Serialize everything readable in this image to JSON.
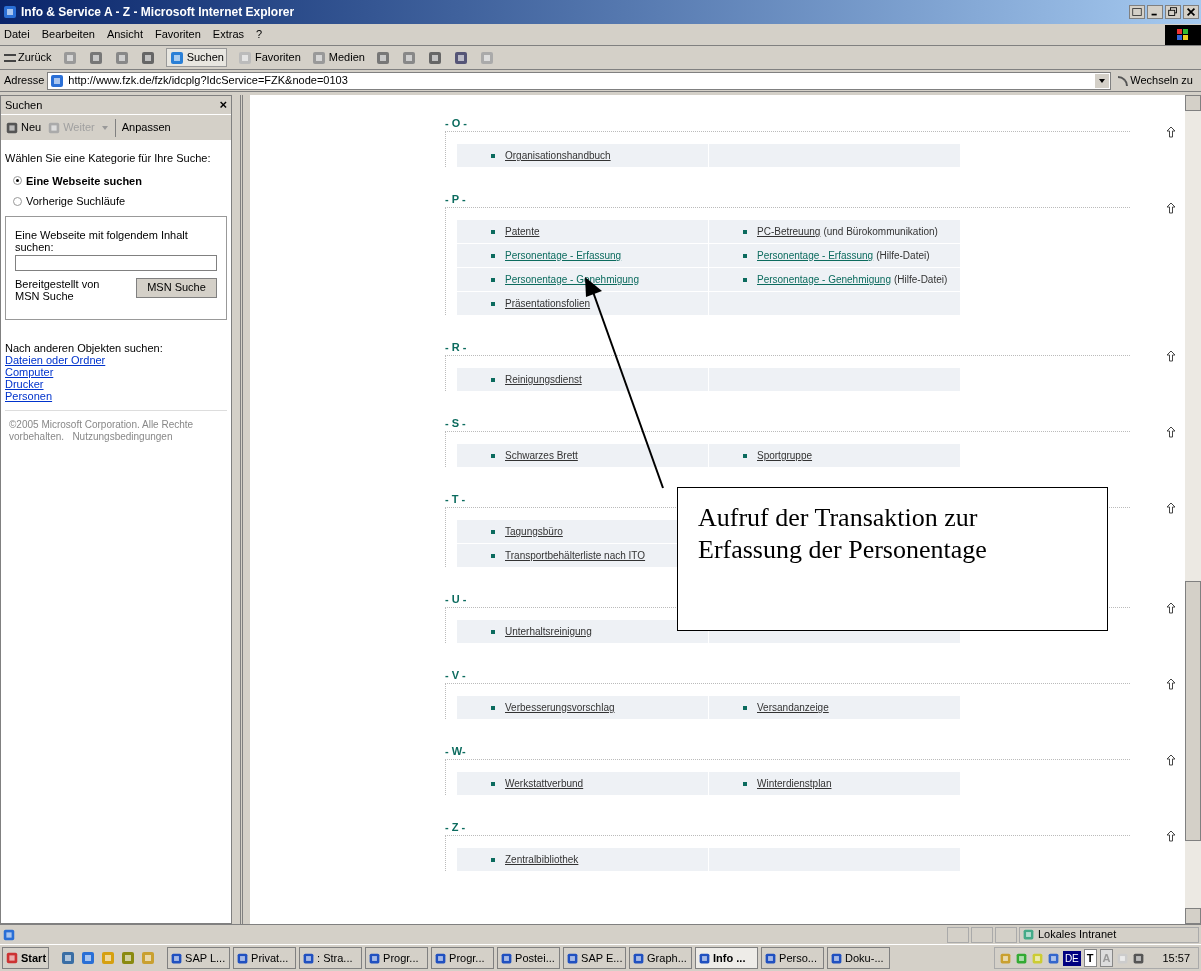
{
  "window": {
    "title": "Info & Service A - Z - Microsoft Internet Explorer"
  },
  "menu": [
    "Datei",
    "Bearbeiten",
    "Ansicht",
    "Favoriten",
    "Extras",
    "?"
  ],
  "toolbar": {
    "back": "Zurück",
    "search": "Suchen",
    "favorites": "Favoriten",
    "media": "Medien"
  },
  "address": {
    "label": "Adresse",
    "url": "http://www.fzk.de/fzk/idcplg?IdcService=FZK&node=0103",
    "go": "Wechseln zu"
  },
  "search_panel": {
    "title": "Suchen",
    "close": "×",
    "new": "Neu",
    "next": {
      "label": "Weiter",
      "disabled": true
    },
    "customize": "Anpassen",
    "prompt": "Wählen Sie eine Kategorie für Ihre Suche:",
    "options": [
      {
        "label": "Eine Webseite suchen",
        "selected": true
      },
      {
        "label": "Vorherige Suchläufe",
        "selected": false
      }
    ],
    "field_label": "Eine Webseite mit folgendem Inhalt suchen:",
    "provider": "Bereitgestellt von MSN Suche",
    "button": "MSN Suche",
    "other_label": "Nach anderen Objekten suchen:",
    "links": [
      "Dateien oder Ordner",
      "Computer",
      "Drucker",
      "Personen"
    ],
    "copyright": "©2005 Microsoft Corporation. Alle Rechte vorbehalten.",
    "terms": "Nutzungsbedingungen"
  },
  "sections": [
    {
      "letter": "- O -",
      "rows": [
        [
          {
            "link": "Organisationshandbuch",
            "visited": true
          },
          {}
        ]
      ]
    },
    {
      "letter": "- P -",
      "rows": [
        [
          {
            "link": "Patente",
            "visited": true
          },
          {
            "link": "PC-Betreuung",
            "note": "(und Bürokommunikation)",
            "visited": true
          }
        ],
        [
          {
            "link": "Personentage - Erfassung",
            "visited": false
          },
          {
            "link": "Personentage - Erfassung",
            "note": "(Hilfe-Datei)",
            "visited": false
          }
        ],
        [
          {
            "link": "Personentage - Genehmigung",
            "visited": false
          },
          {
            "link": "Personentage - Genehmigung",
            "note": "(Hilfe-Datei)",
            "visited": false
          }
        ],
        [
          {
            "link": "Präsentationsfolien",
            "visited": true
          },
          {}
        ]
      ]
    },
    {
      "letter": "- R -",
      "rows": [
        [
          {
            "link": "Reinigungsdienst",
            "visited": true
          },
          {}
        ]
      ]
    },
    {
      "letter": "- S -",
      "rows": [
        [
          {
            "link": "Schwarzes Brett",
            "visited": true
          },
          {
            "link": "Sportgruppe",
            "visited": true
          }
        ]
      ]
    },
    {
      "letter": "- T -",
      "rows": [
        [
          {
            "link": "Tagungsbüro",
            "visited": true
          }
        ],
        [
          {
            "link": "Transportbehälterliste nach ITO",
            "visited": true
          }
        ]
      ]
    },
    {
      "letter": "- U -",
      "rows": [
        [
          {
            "link": "Unterhaltsreinigung",
            "visited": true
          },
          {}
        ]
      ]
    },
    {
      "letter": "- V -",
      "rows": [
        [
          {
            "link": "Verbesserungsvorschlag",
            "visited": true
          },
          {
            "link": "Versandanzeige",
            "visited": true
          }
        ]
      ]
    },
    {
      "letter": "- W-",
      "rows": [
        [
          {
            "link": "Werkstattverbund",
            "visited": true
          },
          {
            "link": "Winterdienstplan",
            "visited": true
          }
        ]
      ]
    },
    {
      "letter": "- Z -",
      "rows": [
        [
          {
            "link": "Zentralbibliothek",
            "visited": true
          },
          {}
        ]
      ]
    }
  ],
  "callout": "Aufruf der Transaktion zur Erfassung der Personentage",
  "status_bar": {
    "zone": "Lokales Intranet"
  },
  "taskbar": {
    "start": "Start",
    "tasks": [
      {
        "label": "SAP L...",
        "selected": false
      },
      {
        "label": "Privat...",
        "selected": false
      },
      {
        "label": ": Stra...",
        "selected": false
      },
      {
        "label": "Progr...",
        "selected": false
      },
      {
        "label": "Progr...",
        "selected": false
      },
      {
        "label": "Postei...",
        "selected": false
      },
      {
        "label": "SAP E...",
        "selected": false
      },
      {
        "label": "Graph...",
        "selected": false
      },
      {
        "label": "Info ...",
        "selected": true
      },
      {
        "label": "Perso...",
        "selected": false
      },
      {
        "label": "Doku-...",
        "selected": false
      }
    ],
    "language": "DE",
    "tray_letters": [
      "T",
      "A"
    ],
    "clock": "15:57"
  }
}
